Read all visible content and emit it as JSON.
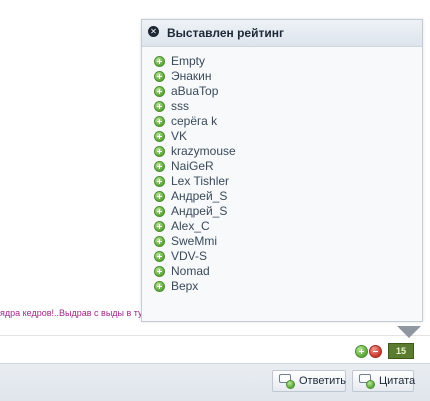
{
  "popup": {
    "title": "Выставлен рейтинг",
    "close_icon": "close-icon",
    "users": [
      "Empty",
      "Энакин",
      "aBuaTop",
      "sss",
      "серёга k",
      "VK",
      "krazymouse",
      "NaiGeR",
      "Lex Tishler",
      "Андрей_S",
      "Андрей_S",
      "Alex_C",
      "SweMmi",
      "VDV-S",
      "Nomad",
      "Верх"
    ]
  },
  "post": {
    "text": "ядра кедров!..Выдрав с выды в тун"
  },
  "reputation": {
    "count": "15",
    "colors": {
      "positive": "#5da83a",
      "negative": "#c8372c",
      "count_bg": "#5b7b2f"
    }
  },
  "buttons": {
    "reply_label": "Ответить",
    "quote_label": "Цитата"
  }
}
